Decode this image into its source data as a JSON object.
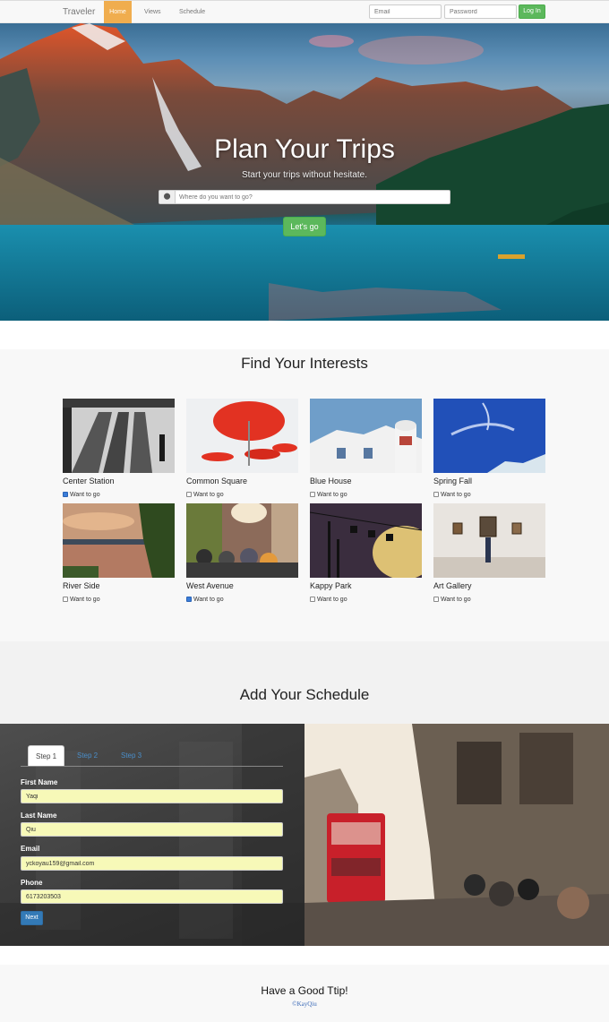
{
  "navbar": {
    "brand": "Traveler",
    "links": [
      "Home",
      "Views",
      "Schedule"
    ],
    "active": "Home",
    "email_placeholder": "Email",
    "password_placeholder": "Password",
    "login_label": "Log In"
  },
  "hero": {
    "title": "Plan Your Trips",
    "subtitle": "Start your trips without hesitate.",
    "search_icon": "map-marker-icon",
    "search_placeholder": "Where do you want to go?",
    "go_label": "Let's go"
  },
  "interests": {
    "title": "Find Your Interests",
    "cards": [
      {
        "name": "Center Station",
        "checkbox_label": "Want to go",
        "checked": true
      },
      {
        "name": "Common Square",
        "checkbox_label": "Want to go",
        "checked": false
      },
      {
        "name": "Blue House",
        "checkbox_label": "Want to go",
        "checked": false
      },
      {
        "name": "Spring Fall",
        "checkbox_label": "Want to go",
        "checked": false
      },
      {
        "name": "River Side",
        "checkbox_label": "Want to go",
        "checked": false
      },
      {
        "name": "West Avenue",
        "checkbox_label": "Want to go",
        "checked": true
      },
      {
        "name": "Kappy Park",
        "checkbox_label": "Want to go",
        "checked": false
      },
      {
        "name": "Art Gallery",
        "checkbox_label": "Want to go",
        "checked": false
      }
    ]
  },
  "schedule": {
    "title": "Add Your Schedule",
    "tabs": [
      "Step 1",
      "Step 2",
      "Step 3"
    ],
    "active_tab": "Step 1",
    "fields": [
      {
        "label": "First Name",
        "value": "Yaqi"
      },
      {
        "label": "Last Name",
        "value": "Qiu"
      },
      {
        "label": "Email",
        "value": "yckoyau159@gmail.com"
      },
      {
        "label": "Phone",
        "value": "6173203503"
      }
    ],
    "next_label": "Next"
  },
  "footer": {
    "title": "Have a Good Ttip!",
    "credit": "©KayQiu"
  },
  "colors": {
    "active_nav": "#f0ad4e",
    "success": "#5cb85c",
    "primary": "#337ab7",
    "input_fill": "#f7f9b8"
  }
}
